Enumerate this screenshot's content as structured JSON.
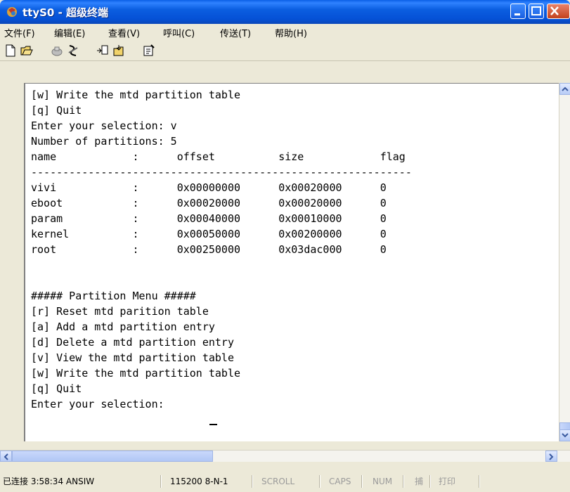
{
  "window": {
    "title": "ttyS0 - 超级终端",
    "colors": {
      "titlebar": "#0551d6",
      "terminal_bg": "#ffffff",
      "text": "#000000"
    }
  },
  "menu": {
    "file": "文件(F)",
    "edit": "编辑(E)",
    "view": "查看(V)",
    "call": "呼叫(C)",
    "transfer": "传送(T)",
    "help": "帮助(H)"
  },
  "toolbar": {
    "icons": [
      "new-icon",
      "open-icon",
      "connect-icon",
      "disconnect-icon",
      "send-icon",
      "receive-icon",
      "properties-icon"
    ]
  },
  "terminal": {
    "lines": [
      "[w] Write the mtd partition table",
      "[q] Quit",
      "Enter your selection: v",
      "Number of partitions: 5",
      "name            :      offset          size            flag",
      "------------------------------------------------------------",
      "vivi            :      0x00000000      0x00020000      0",
      "eboot           :      0x00020000      0x00020000      0",
      "param           :      0x00040000      0x00010000      0",
      "kernel          :      0x00050000      0x00200000      0",
      "root            :      0x00250000      0x03dac000      0",
      "",
      "##### Partition Menu #####",
      "[r] Reset mtd parition table",
      "[a] Add a mtd partition entry",
      "[d] Delete a mtd partition entry",
      "[v] View the mtd partition table",
      "[w] Write the mtd partition table",
      "[q] Quit",
      "Enter your selection: "
    ]
  },
  "status": {
    "connection": "已连接 3:58:34 ANSIW",
    "port": "115200 8-N-1",
    "scroll": "SCROLL",
    "caps": "CAPS",
    "num": "NUM",
    "capture": "捕",
    "print": "打印"
  }
}
